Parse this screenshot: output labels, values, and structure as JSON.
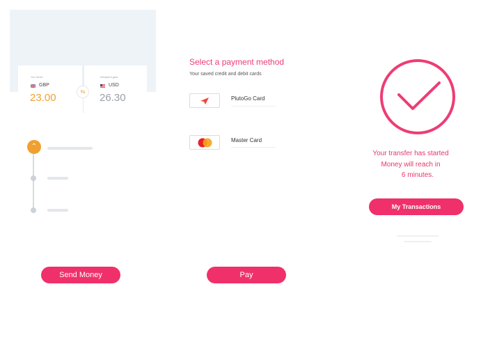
{
  "exchange": {
    "you_send_label": "You Send",
    "they_get_label": "Recipient gets",
    "from_currency": "GBP",
    "from_amount": "23.00",
    "to_currency": "USD",
    "to_amount": "26.30"
  },
  "send_button": "Send Money",
  "payment": {
    "title": "Select a payment method",
    "subtitle": "Your saved credit and debit cards",
    "methods": [
      {
        "label": "PlutoGo Card",
        "icon": "plutogo-logo-icon"
      },
      {
        "label": "Master Card",
        "icon": "mastercard-logo-icon"
      }
    ],
    "pay_button": "Pay"
  },
  "confirmation": {
    "line1": "Your transfer has started",
    "line2": "Money will reach in",
    "line3": "6 minutes.",
    "button": "My Transactions"
  },
  "colors": {
    "accent": "#f0306a",
    "orange": "#f0a030",
    "gray_amount": "#9aa0a8"
  }
}
